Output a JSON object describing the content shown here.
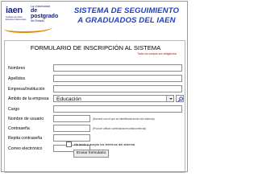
{
  "header": {
    "logo_word": "iaen",
    "logo_university": "La Universidad",
    "logo_postgrado": "de postgrado",
    "logo_state": "del Estado",
    "logo_tagline": "Instituto de Altos Estudios Nacionales",
    "title_line1": "SISTEMA DE SEGUIMIENTO",
    "title_line2": "A GRADUADOS DEL IAEN"
  },
  "form": {
    "title": "FORMULARIO DE INSCRIPCIÓN AL SISTEMA",
    "required_note": "Todos los campos son obligatorios",
    "fields": [
      {
        "label": "Nombres",
        "value": ""
      },
      {
        "label": "Apellidos",
        "value": ""
      },
      {
        "label": "Empresa/Institución",
        "value": ""
      },
      {
        "label": "Ámbito de la empresa",
        "value": "Educación"
      },
      {
        "label": "Cargo",
        "value": ""
      },
      {
        "label": "Nombre de usuario",
        "value": "",
        "hint": "(Nombre con el que se identificará dentro del sistema)"
      },
      {
        "label": "Contraseña",
        "value": "",
        "hint": "(Procure utilizar combinaciones alfanuméricas)"
      },
      {
        "label": "Repita contraseña",
        "value": ""
      },
      {
        "label": "Correo electrónico",
        "value": ""
      }
    ],
    "terms_label": "He leído y acepto los términos del sistema",
    "submit_label": "Enviar formulario"
  },
  "icons": {
    "search": "search-icon",
    "dropdown": "chevron-down-icon"
  },
  "colors": {
    "title_blue": "#1f3fbf",
    "brand_navy": "#1a237e",
    "brand_orange": "#f0a000",
    "required_red": "#c00000"
  }
}
